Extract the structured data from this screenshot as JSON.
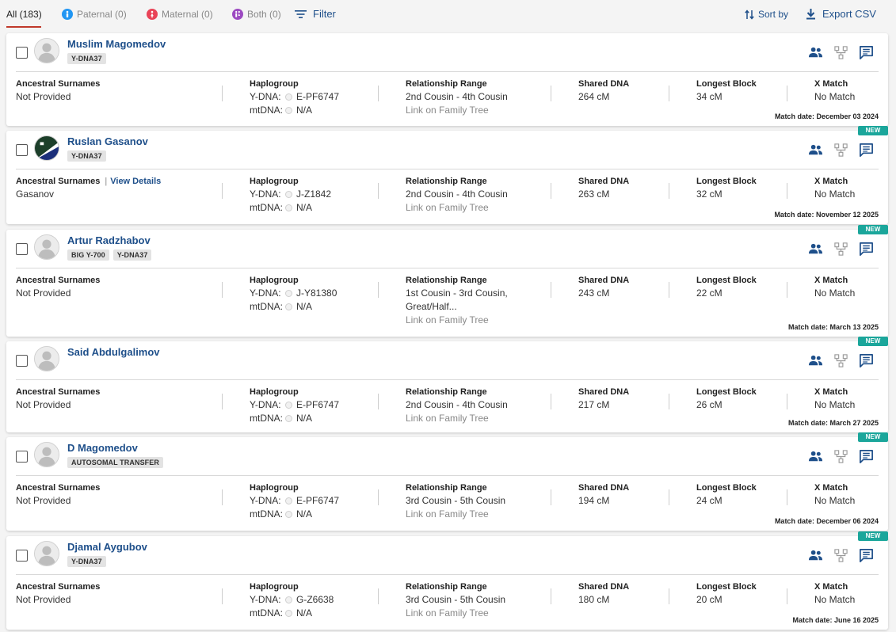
{
  "tabs": [
    {
      "label": "All (183)",
      "icon": ""
    },
    {
      "label": "Paternal (0)",
      "icon": "paternal-icon",
      "color": "#2196f3"
    },
    {
      "label": "Maternal (0)",
      "icon": "maternal-icon",
      "color": "#e94357"
    },
    {
      "label": "Both (0)",
      "icon": "both-icon",
      "color": "#9c4ac1"
    }
  ],
  "toolbar": {
    "filter_label": "Filter",
    "sort_label": "Sort by",
    "export_label": "Export CSV"
  },
  "colors": {
    "link_blue": "#1e4f8a",
    "new_tag": "#1ba69b",
    "tab_underline": "#c0392b"
  },
  "labels": {
    "ancestral_surnames": "Ancestral Surnames",
    "view_details": "View Details",
    "haplogroup": "Haplogroup",
    "ydna": "Y-DNA:",
    "mtdna": "mtDNA:",
    "relationship_range": "Relationship Range",
    "link_family_tree": "Link on Family Tree",
    "shared_dna": "Shared DNA",
    "longest_block": "Longest Block",
    "x_match": "X Match",
    "new": "NEW"
  },
  "matches": [
    {
      "name": "Muslim Magomedov",
      "badges": [
        "Y-DNA37"
      ],
      "avatar": "default-avatar-icon",
      "is_new": false,
      "surnames": "Not Provided",
      "has_view_details": false,
      "ydna": "E-PF6747",
      "mtdna": "N/A",
      "relationship": [
        "2nd Cousin - 4th Cousin"
      ],
      "shared_dna": "264 cM",
      "longest_block": "34 cM",
      "x_match": "No Match",
      "match_date": "Match date: December 03 2024"
    },
    {
      "name": "Ruslan Gasanov",
      "badges": [
        "Y-DNA37"
      ],
      "avatar": "flag-avatar-icon",
      "is_new": true,
      "surnames": "Gasanov",
      "has_view_details": true,
      "ydna": "J-Z1842",
      "mtdna": "N/A",
      "relationship": [
        "2nd Cousin - 4th Cousin"
      ],
      "shared_dna": "263 cM",
      "longest_block": "32 cM",
      "x_match": "No Match",
      "match_date": "Match date: November 12 2025"
    },
    {
      "name": "Artur Radzhabov",
      "badges": [
        "BIG Y-700",
        "Y-DNA37"
      ],
      "avatar": "default-avatar-icon",
      "is_new": true,
      "surnames": "Not Provided",
      "has_view_details": false,
      "ydna": "J-Y81380",
      "mtdna": "N/A",
      "relationship": [
        "1st Cousin - 3rd Cousin,",
        "Great/Half..."
      ],
      "shared_dna": "243 cM",
      "longest_block": "22 cM",
      "x_match": "No Match",
      "match_date": "Match date: March 13 2025"
    },
    {
      "name": "Said Abdulgalimov",
      "badges": [],
      "avatar": "default-avatar-icon",
      "is_new": true,
      "surnames": "Not Provided",
      "has_view_details": false,
      "ydna": "E-PF6747",
      "mtdna": "N/A",
      "relationship": [
        "2nd Cousin - 4th Cousin"
      ],
      "shared_dna": "217 cM",
      "longest_block": "26 cM",
      "x_match": "No Match",
      "match_date": "Match date: March 27 2025"
    },
    {
      "name": "D Magomedov",
      "badges": [
        "AUTOSOMAL TRANSFER"
      ],
      "avatar": "default-avatar-icon",
      "is_new": true,
      "surnames": "Not Provided",
      "has_view_details": false,
      "ydna": "E-PF6747",
      "mtdna": "N/A",
      "relationship": [
        "3rd Cousin - 5th Cousin"
      ],
      "shared_dna": "194 cM",
      "longest_block": "24 cM",
      "x_match": "No Match",
      "match_date": "Match date: December 06 2024"
    },
    {
      "name": "Djamal Aygubov",
      "badges": [
        "Y-DNA37"
      ],
      "avatar": "default-avatar-icon",
      "is_new": true,
      "surnames": "Not Provided",
      "has_view_details": false,
      "ydna": "G-Z6638",
      "mtdna": "N/A",
      "relationship": [
        "3rd Cousin - 5th Cousin"
      ],
      "shared_dna": "180 cM",
      "longest_block": "20 cM",
      "x_match": "No Match",
      "match_date": "Match date: June 16 2025"
    }
  ]
}
